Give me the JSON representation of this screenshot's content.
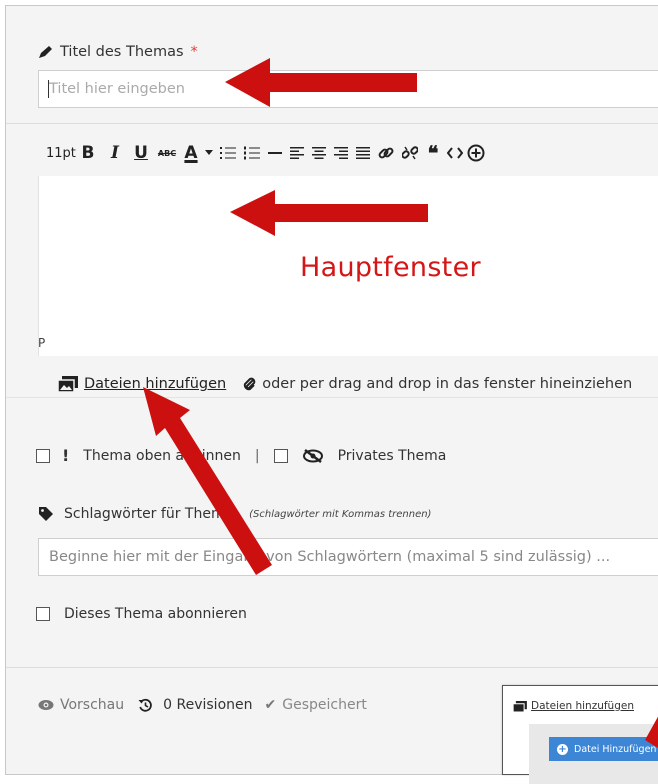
{
  "title_section": {
    "label": "Titel des Themas",
    "required_marker": "*",
    "placeholder": "Titel hier eingeben"
  },
  "toolbar": {
    "font_size": "11pt",
    "bold": "B",
    "italic": "I",
    "underline": "U",
    "strikethrough": "ABC",
    "font_color": "A",
    "tools": [
      "bold",
      "italic",
      "underline",
      "strikethrough",
      "font-color",
      "bullet-list",
      "numbered-list",
      "horizontal-rule",
      "align-left",
      "align-center",
      "align-right",
      "align-justify",
      "link",
      "unlink",
      "quote",
      "code",
      "insert"
    ]
  },
  "editor": {
    "status_path": "P",
    "annotation": "Hauptfenster"
  },
  "attachments": {
    "link_label": "Dateien hinzufügen",
    "drag_hint": "oder per drag and drop in das fenster hineinziehen"
  },
  "options": {
    "pin_label": "Thema oben anpinnen",
    "separator": "|",
    "private_label": "Privates Thema"
  },
  "tags": {
    "label": "Schlagwörter für Thema",
    "hint": "(Schlagwörter mit Kommas trennen)",
    "placeholder": "Beginne hier mit der Eingabe von Schlagwörtern (maximal 5 sind zulässig) ..."
  },
  "subscribe": {
    "label": "Dieses Thema abonnieren"
  },
  "footer": {
    "preview_label": "Vorschau",
    "revisions_label": "0 Revisionen",
    "saved_label": "Gespeichert"
  },
  "inset": {
    "link_label": "Dateien hinzufügen",
    "button_label": "Datei Hinzufügen"
  },
  "colors": {
    "required": "#e0403a",
    "annotation": "#d51616",
    "arrow": "#cc1010",
    "button_blue": "#3d86d6"
  }
}
